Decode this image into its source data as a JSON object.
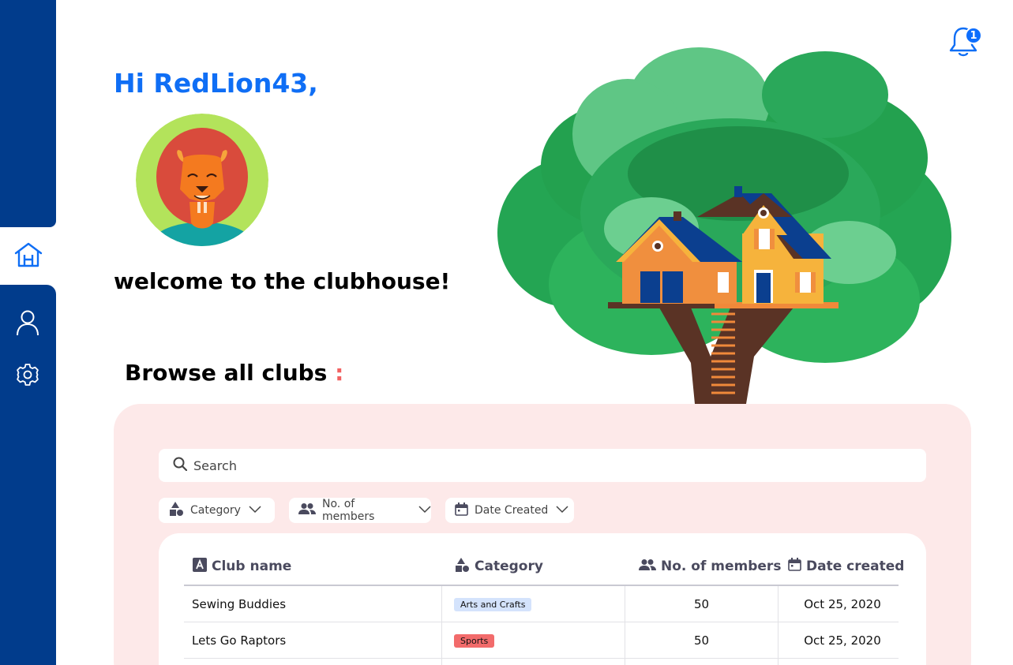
{
  "user": {
    "greeting": "Hi RedLion43,",
    "welcome": "welcome to the clubhouse!"
  },
  "notifications": {
    "count": "1"
  },
  "sidebar": {
    "icons": [
      "home-icon",
      "profile-icon",
      "settings-icon"
    ]
  },
  "browse": {
    "title": "Browse all clubs",
    "colon": ":"
  },
  "search": {
    "placeholder": "Search"
  },
  "filters": [
    {
      "label": "Category",
      "icon": "shapes-icon"
    },
    {
      "label": "No. of members",
      "icon": "people-icon"
    },
    {
      "label": "Date Created",
      "icon": "calendar-icon"
    }
  ],
  "table": {
    "headers": [
      "Club name",
      "Category",
      "No. of members",
      "Date created"
    ],
    "rows": [
      {
        "name": "Sewing Buddies",
        "category": "Arts and Crafts",
        "category_color": "#d4e3fc",
        "members": "50",
        "date": "Oct 25, 2020"
      },
      {
        "name": "Lets Go Raptors",
        "category": "Sports",
        "category_color": "#f26b6b",
        "members": "50",
        "date": "Oct 25, 2020"
      }
    ]
  },
  "colors": {
    "sidebar": "#013c8c",
    "accent": "#0f6ef5",
    "panel": "#fde9e9",
    "colon": "#f26161"
  }
}
